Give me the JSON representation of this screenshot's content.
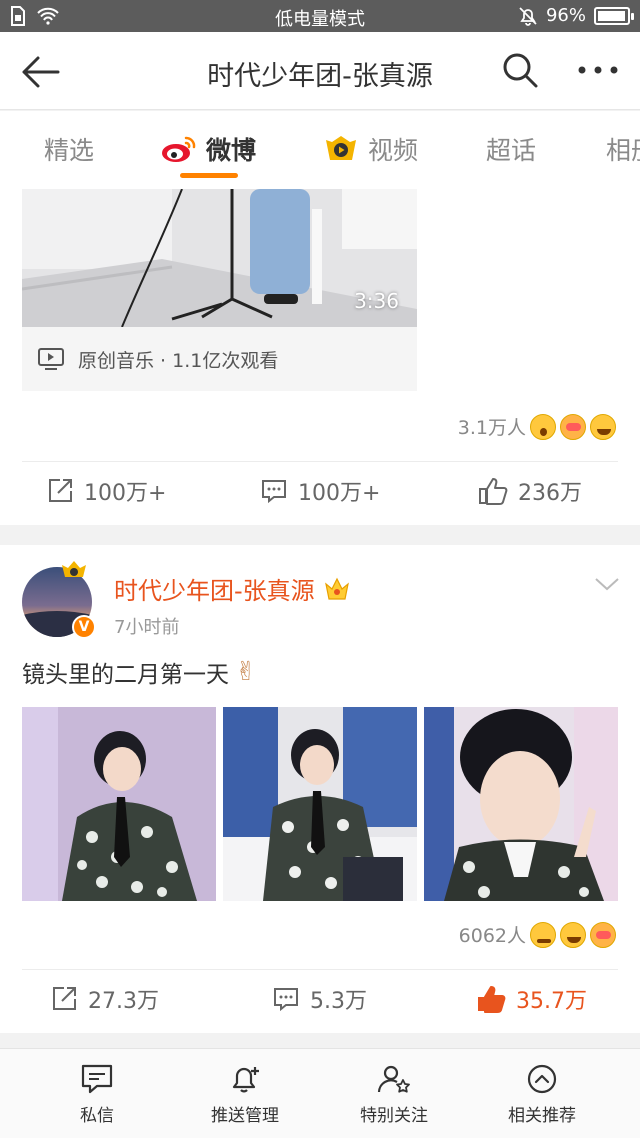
{
  "status_bar": {
    "mode": "低电量模式",
    "battery_percent": "96%",
    "battery_level": 0.96
  },
  "header": {
    "title": "时代少年团-张真源"
  },
  "tabs": [
    {
      "label": "精选",
      "icon": null,
      "active": false
    },
    {
      "label": "微博",
      "icon": "weibo-logo-icon",
      "active": true
    },
    {
      "label": "视频",
      "icon": "video-play-icon",
      "active": false
    },
    {
      "label": "超话",
      "icon": null,
      "active": false
    },
    {
      "label": "相册",
      "icon": null,
      "active": false
    }
  ],
  "colors": {
    "accent": "#ff8200",
    "liked": "#e8541e",
    "author_name": "#e8541e"
  },
  "post1": {
    "video_duration": "3:36",
    "video_caption": "原创音乐 · 1.1亿次观看",
    "reaction_count": "3.1万人",
    "reposts": "100万+",
    "comments": "100万+",
    "likes": "236万"
  },
  "post2": {
    "author": "时代少年团-张真源",
    "verified_badge": "V",
    "time": "7小时前",
    "text": "镜头里的二月第一天",
    "text_emoji": "✌",
    "reaction_count": "6062人",
    "reposts": "27.3万",
    "comments": "5.3万",
    "likes": "35.7万",
    "liked": true
  },
  "bottom_nav": [
    {
      "label": "私信",
      "icon": "message-icon"
    },
    {
      "label": "推送管理",
      "icon": "bell-plus-icon"
    },
    {
      "label": "特别关注",
      "icon": "person-star-icon"
    },
    {
      "label": "相关推荐",
      "icon": "chevron-up-circle-icon"
    }
  ]
}
